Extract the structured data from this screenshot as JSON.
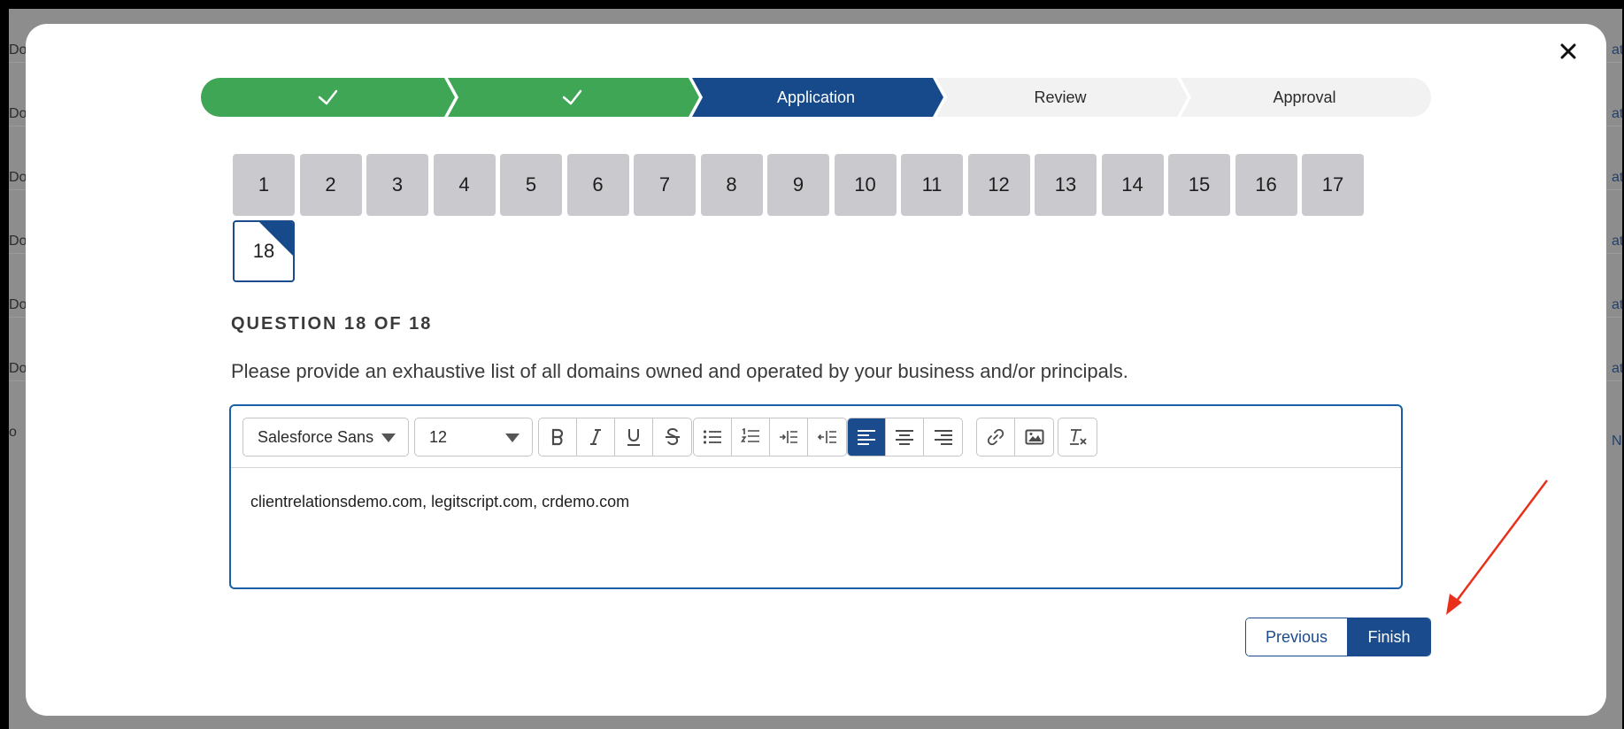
{
  "background": {
    "left_fragments": [
      "Do",
      "Do",
      "Do",
      "Do",
      "Do",
      "Do",
      "o"
    ],
    "right_fragments": [
      "at",
      "at",
      "at",
      "at",
      "at",
      "at",
      "N"
    ]
  },
  "progress": {
    "steps": [
      {
        "label": "",
        "state": "complete"
      },
      {
        "label": "",
        "state": "complete"
      },
      {
        "label": "Application",
        "state": "current"
      },
      {
        "label": "Review",
        "state": "upcoming"
      },
      {
        "label": "Approval",
        "state": "upcoming"
      }
    ],
    "colors": {
      "complete": "#3ea655",
      "current": "#174a8b",
      "upcoming": "#f2f2f2"
    }
  },
  "questions": {
    "numbers": [
      "1",
      "2",
      "3",
      "4",
      "5",
      "6",
      "7",
      "8",
      "9",
      "10",
      "11",
      "12",
      "13",
      "14",
      "15",
      "16",
      "17",
      "18"
    ],
    "active": "18"
  },
  "question": {
    "heading": "QUESTION 18 OF 18",
    "text": "Please provide an exhaustive list of all domains owned and operated by your business and/or principals."
  },
  "editor": {
    "font_value": "Salesforce Sans",
    "size_value": "12",
    "content": "clientrelationsdemo.com, legitscript.com, crdemo.com",
    "toolbar_icons": [
      "bold-icon",
      "italic-icon",
      "underline-icon",
      "strikethrough-icon",
      "bullet-list-icon",
      "numbered-list-icon",
      "indent-icon",
      "outdent-icon",
      "align-left-icon",
      "align-center-icon",
      "align-right-icon",
      "link-icon",
      "image-icon",
      "clear-format-icon"
    ]
  },
  "buttons": {
    "previous": "Previous",
    "finish": "Finish"
  },
  "annotation": {
    "arrow_color": "#e8301c"
  }
}
